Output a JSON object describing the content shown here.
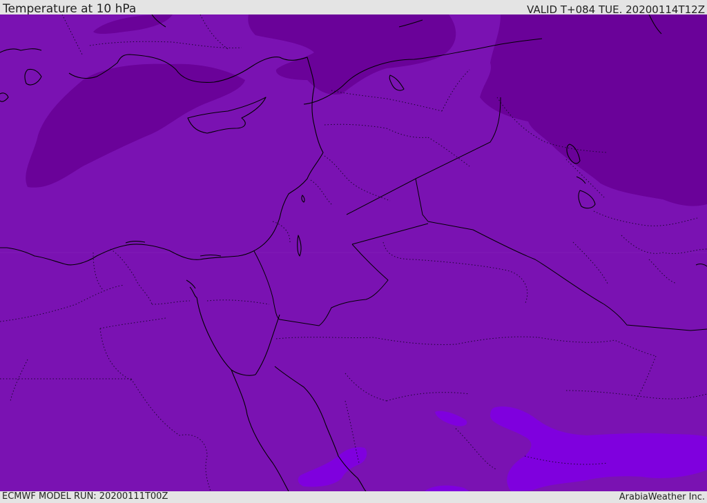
{
  "header": {
    "title": "Temperature at 10 hPa",
    "valid_time": "VALID T+084 TUE. 20200114T12Z"
  },
  "footer": {
    "model_run": "ECMWF MODEL RUN: 20200111T00Z",
    "credit": "ArabiaWeather Inc."
  },
  "colors": {
    "base_field": "#7a12b2",
    "cold_shade": "#6a0299",
    "warm_shade": "#7f00de",
    "coastline": "#000000"
  }
}
